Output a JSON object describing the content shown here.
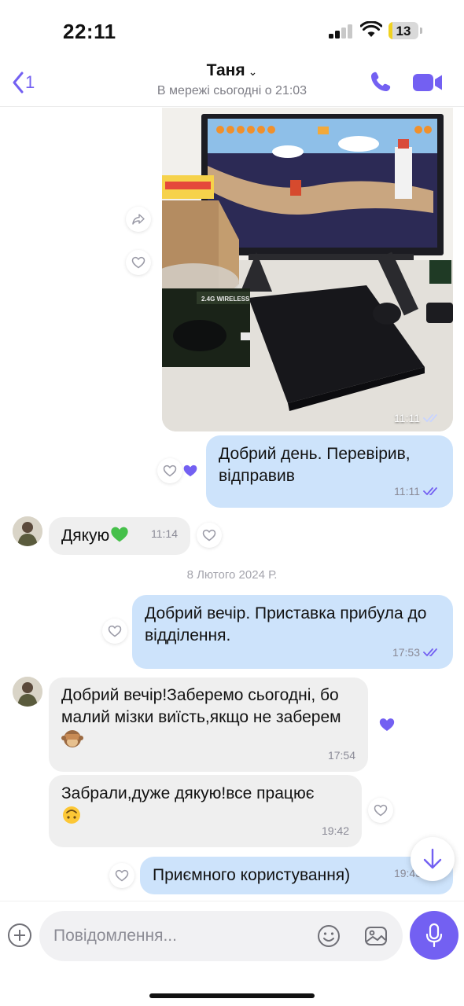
{
  "status_bar": {
    "time": "22:11",
    "battery": "13",
    "battery_level_percent": 13
  },
  "header": {
    "back_count": "1",
    "contact_name": "Таня",
    "contact_status": "В мережі сьогодні о 21:03"
  },
  "messages": [
    {
      "type": "photo",
      "direction": "outgoing",
      "time": "11:11"
    },
    {
      "direction": "outgoing",
      "text": "Добрий день. Перевірив, відправив",
      "time": "11:11"
    },
    {
      "direction": "incoming",
      "text": "Дякую",
      "emoji": "green-heart",
      "time": "11:14"
    },
    {
      "type": "date",
      "text": "8 Лютого 2024 Р."
    },
    {
      "direction": "outgoing",
      "text": "Добрий вечір. Приставка прибула до відділення.",
      "time": "17:53"
    },
    {
      "direction": "incoming",
      "text": "Добрий вечір!Заберемо сьогодні, бо малий мізки виїсть,якщо не заберем",
      "emoji": "see-no-evil-monkey",
      "time": "17:54"
    },
    {
      "direction": "incoming",
      "text": "Забрали,дуже дякую!все працює",
      "emoji": "upside-down-face",
      "time": "19:42"
    },
    {
      "direction": "outgoing",
      "text": "Приємного користування)",
      "time": "19:43"
    }
  ],
  "composer": {
    "placeholder": "Повідомлення..."
  },
  "colors": {
    "accent": "#7360f2",
    "outgoing_bubble": "#cde3fb",
    "incoming_bubble": "#efefef"
  },
  "icons": [
    "back-chevron-icon",
    "phone-icon",
    "video-camera-icon",
    "forward-icon",
    "heart-icon",
    "heart-filled-icon",
    "double-check-icon",
    "arrow-down-icon",
    "plus-icon",
    "sticker-icon",
    "gallery-icon",
    "microphone-icon"
  ]
}
